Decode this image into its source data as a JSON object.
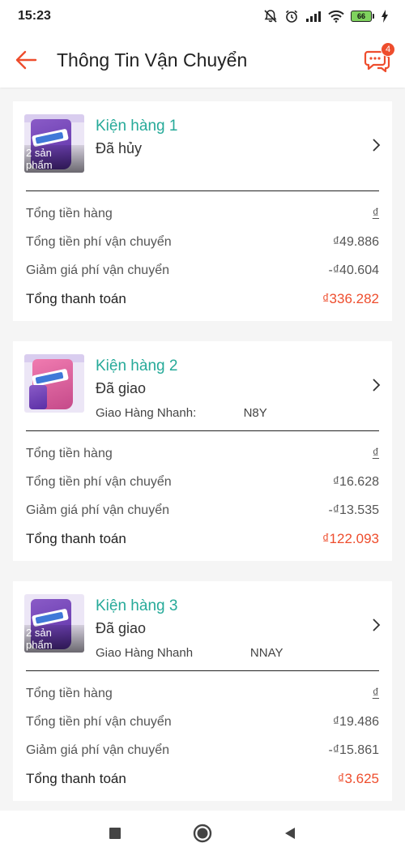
{
  "status_bar": {
    "time": "15:23",
    "battery": "66"
  },
  "header": {
    "title": "Thông Tin Vận Chuyển",
    "chat_badge": "4"
  },
  "packages": [
    {
      "title": "Kiện hàng 1",
      "status": "Đã hủy",
      "carrier": "",
      "thumb_overlay": "2 sản\nphẩm",
      "summary": {
        "subtotal_label": "Tổng tiền hàng",
        "subtotal_value": "₫",
        "shipping_label": "Tổng tiền phí vận chuyển",
        "shipping_value": "₫49.886",
        "discount_label": "Giảm giá phí vận chuyển",
        "discount_value": "-₫40.604",
        "total_label": "Tổng thanh toán",
        "total_value": "₫336.282"
      }
    },
    {
      "title": "Kiện hàng 2",
      "status": "Đã giao",
      "carrier": "Giao Hàng Nhanh:              N8Y",
      "thumb_overlay": "",
      "summary": {
        "subtotal_label": "Tổng tiền hàng",
        "subtotal_value": "₫",
        "shipping_label": "Tổng tiền phí vận chuyển",
        "shipping_value": "₫16.628",
        "discount_label": "Giảm giá phí vận chuyển",
        "discount_value": "-₫13.535",
        "total_label": "Tổng thanh toán",
        "total_value": "₫122.093"
      }
    },
    {
      "title": "Kiện hàng 3",
      "status": "Đã giao",
      "carrier": "Giao Hàng Nhanh                 NNAY",
      "thumb_overlay": "2 sản\nphẩm",
      "summary": {
        "subtotal_label": "Tổng tiền hàng",
        "subtotal_value": "₫",
        "shipping_label": "Tổng tiền phí vận chuyển",
        "shipping_value": "₫19.486",
        "discount_label": "Giảm giá phí vận chuyển",
        "discount_value": "-₫15.861",
        "total_label": "Tổng thanh toán",
        "total_value": "₫3.625"
      }
    }
  ],
  "colors": {
    "accent": "#ee4d2d",
    "package_title": "#26aa99"
  },
  "icons": [
    "back-arrow-icon",
    "chat-icon",
    "chevron-right-icon",
    "nav-square-icon",
    "nav-circle-icon",
    "nav-back-triangle-icon"
  ]
}
